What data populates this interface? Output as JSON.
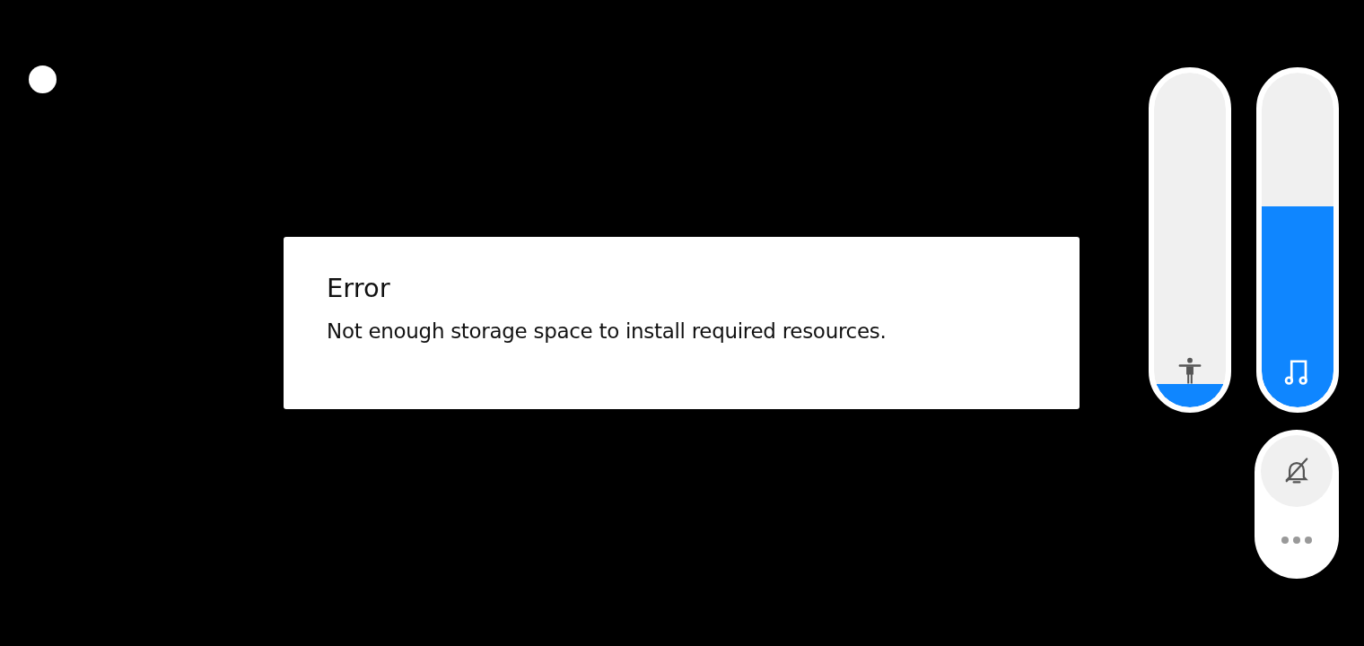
{
  "dialog": {
    "title": "Error",
    "message": "Not enough storage space to install required resources."
  },
  "sliders": [
    {
      "kind": "accessibility",
      "level": 0.07
    },
    {
      "kind": "media",
      "level": 0.6
    }
  ],
  "ringer": {
    "muted": true
  }
}
